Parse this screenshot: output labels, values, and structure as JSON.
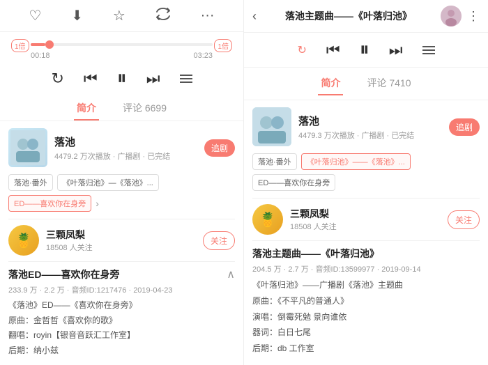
{
  "left": {
    "icons": [
      "heart",
      "download",
      "star",
      "fish",
      "more"
    ],
    "progress": {
      "current": "00:18",
      "total": "03:23",
      "speed_left": "1倍",
      "speed_right": "1倍",
      "percent": 8
    },
    "tabs": [
      {
        "label": "简介",
        "active": true
      },
      {
        "label": "评论 6699",
        "active": false
      }
    ],
    "drama": {
      "title": "落池",
      "meta": "4479.2 万次播放 · 广播剧 · 已完结",
      "follow_label": "追剧"
    },
    "tags": [
      {
        "label": "落池·番外",
        "selected": false
      },
      {
        "label": "《叶落归池》—《落池》...",
        "selected": false
      },
      {
        "label": "ED——喜欢你在身旁",
        "selected": true
      }
    ],
    "singer": {
      "name": "三颗凤梨",
      "fans": "18508 人关注",
      "follow_label": "关注"
    },
    "song": {
      "title": "落池ED——喜欢你在身旁",
      "plays": "233.9 万",
      "shares": "2.2 万",
      "song_id": "音频ID:1217476",
      "date": "2019-04-23",
      "detail": [
        {
          "label": "《落池》ED——《喜欢你在身旁》"
        },
        {
          "label": "原曲：金哲哲《喜欢你的歌》"
        },
        {
          "label": "翻唱：royin【银音音跃汇工作室】"
        },
        {
          "label": "后期：纳小兹"
        }
      ]
    }
  },
  "right": {
    "header": {
      "title": "落池主题曲——《叶落归池》",
      "back": "‹"
    },
    "tabs": [
      {
        "label": "简介",
        "active": true
      },
      {
        "label": "评论 7410",
        "active": false
      }
    ],
    "drama": {
      "title": "落池",
      "meta": "4479.3 万次播放 · 广播剧 · 已完结",
      "follow_label": "追剧"
    },
    "tags": [
      {
        "label": "落池·番外",
        "selected": false
      },
      {
        "label": "《叶落归池》——《落池》...",
        "selected": true
      },
      {
        "label": "ED——喜欢你在身旁",
        "selected": false
      }
    ],
    "singer": {
      "name": "三颗凤梨",
      "fans": "18508 人关注",
      "follow_label": "关注"
    },
    "song": {
      "title": "落池主题曲——《叶落归池》",
      "plays": "204.5 万",
      "shares": "2.7 万",
      "song_id": "音频ID:13599977",
      "date": "2019-09-14",
      "detail": [
        {
          "label": "《叶落归池》——广播剧《落池》主题曲"
        },
        {
          "label": "原曲：《不平凡的普通人》"
        },
        {
          "label": "演唱：倒霉死勉 景向谁依"
        },
        {
          "label": "器词：白日七尾"
        },
        {
          "label": "后期：db 工作室"
        }
      ]
    }
  }
}
